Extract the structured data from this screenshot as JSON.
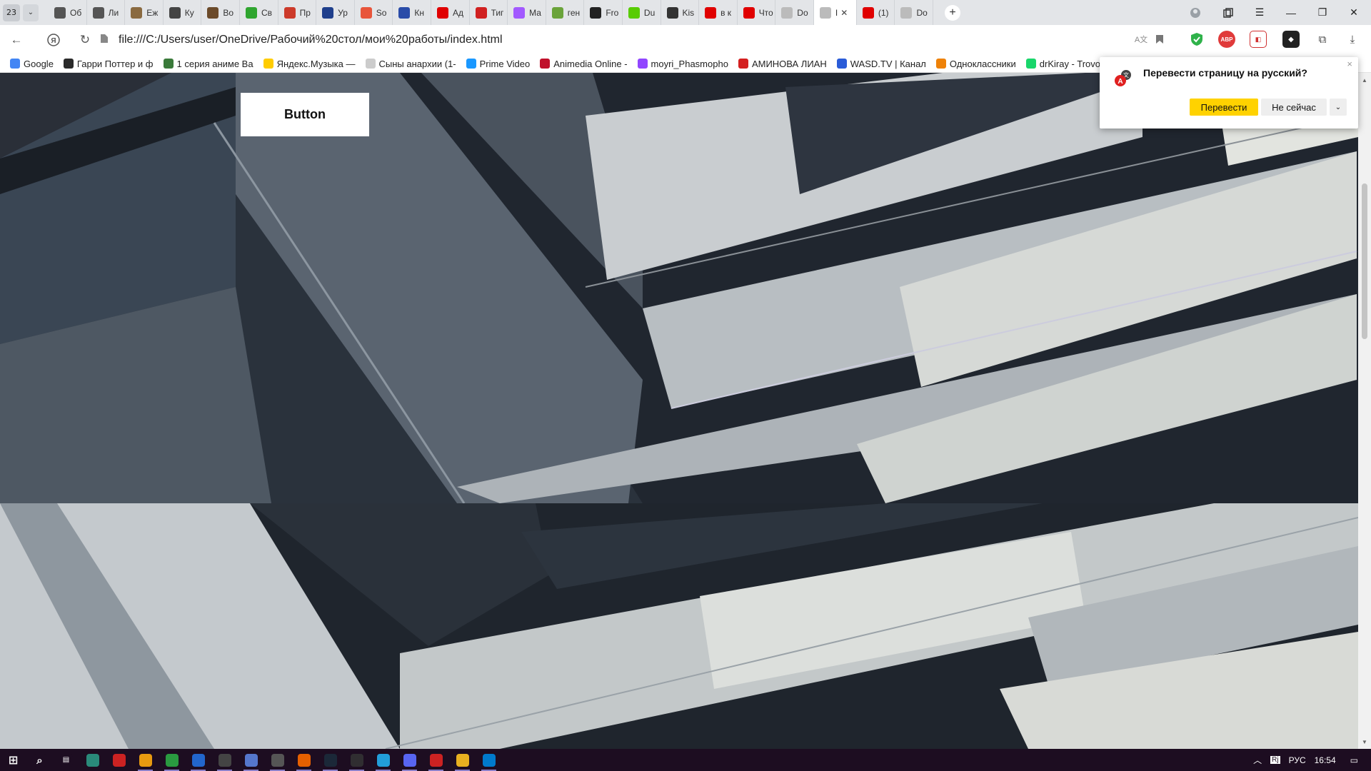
{
  "browser": {
    "tab_count": "23",
    "tabs": [
      {
        "label": "Об",
        "icon": "shield-icon",
        "color": "#555555"
      },
      {
        "label": "Ли",
        "icon": "shield-icon",
        "color": "#555555"
      },
      {
        "label": "Еж",
        "icon": "hedgehog-icon",
        "color": "#8a6a40"
      },
      {
        "label": "Ку",
        "icon": "shield-outline-icon",
        "color": "#444444"
      },
      {
        "label": "Во",
        "icon": "bird-icon",
        "color": "#6b4a2a"
      },
      {
        "label": "Св",
        "icon": "hd-icon",
        "color": "#2fa52f"
      },
      {
        "label": "Пр",
        "icon": "logo-icon",
        "color": "#cc3a2a"
      },
      {
        "label": "Ур",
        "icon": "uk-flag-icon",
        "color": "#1f3f8c"
      },
      {
        "label": "So",
        "icon": "soundcloud-icon",
        "color": "#e8553b"
      },
      {
        "label": "Кн",
        "icon": "flag-icon",
        "color": "#2a4ca8"
      },
      {
        "label": "Ад",
        "icon": "youtube-icon",
        "color": "#e00000"
      },
      {
        "label": "Тиг",
        "icon": "tiger-icon",
        "color": "#d02020"
      },
      {
        "label": "Ма",
        "icon": "figma-icon",
        "color": "#a259ff"
      },
      {
        "label": "ген",
        "icon": "leaf-icon",
        "color": "#6aa33a"
      },
      {
        "label": "Fro",
        "icon": "circle-icon",
        "color": "#222222"
      },
      {
        "label": "Du",
        "icon": "duolingo-icon",
        "color": "#58cc02"
      },
      {
        "label": "Kis",
        "icon": "pause-icon",
        "color": "#333333"
      },
      {
        "label": "в к",
        "icon": "youtube-icon",
        "color": "#e00000"
      },
      {
        "label": "Что",
        "icon": "youtube-icon",
        "color": "#e00000"
      },
      {
        "label": "Do",
        "icon": "document-icon",
        "color": "#bbbbbb"
      },
      {
        "label": "I",
        "icon": "document-icon",
        "color": "#bbbbbb",
        "active": true
      },
      {
        "label": "(1)",
        "icon": "youtube-icon",
        "color": "#e00000"
      },
      {
        "label": "Do",
        "icon": "document-icon",
        "color": "#bbbbbb"
      }
    ],
    "url": "file:///C:/Users/user/OneDrive/Рабочий%20стол/мои%20работы/index.html",
    "bookmarks": [
      {
        "label": "Google",
        "icon": "google-icon",
        "color": "#4285f4"
      },
      {
        "label": "Гарри Поттер и ф",
        "icon": "book-icon",
        "color": "#2a2a2a"
      },
      {
        "label": "1 серия аниме Ва",
        "icon": "eye-icon",
        "color": "#3a7a3a"
      },
      {
        "label": "Яндекс.Музыка —",
        "icon": "music-icon",
        "color": "#ffcc00"
      },
      {
        "label": "Сыны анархии (1-",
        "icon": "document-icon",
        "color": "#cccccc"
      },
      {
        "label": "Prime Video",
        "icon": "play-icon",
        "color": "#1a98ff"
      },
      {
        "label": "Animedia Online -",
        "icon": "animedia-icon",
        "color": "#c0102a"
      },
      {
        "label": "moyri_Phasmopho",
        "icon": "twitch-icon",
        "color": "#9146ff"
      },
      {
        "label": "АМИНОВА ЛИАН",
        "icon": "slash-icon",
        "color": "#d42020"
      },
      {
        "label": "WASD.TV | Канал",
        "icon": "wasd-icon",
        "color": "#2a5cd8"
      },
      {
        "label": "Одноклассники",
        "icon": "ok-icon",
        "color": "#ee8208"
      },
      {
        "label": "drKiray - Trovo",
        "icon": "trovo-icon",
        "color": "#19d66b"
      }
    ]
  },
  "page": {
    "button_label": "Button"
  },
  "translate_popup": {
    "title": "Перевести страницу на русский?",
    "translate_label": "Перевести",
    "not_now_label": "Не сейчас",
    "close_glyph": "×",
    "more_glyph": "⌄"
  },
  "taskbar": {
    "language": "РУС",
    "time": "16:54",
    "apps": [
      {
        "icon": "windows-start-icon",
        "color": "#1d0d21"
      },
      {
        "icon": "search-icon",
        "color": "#1d0d21"
      },
      {
        "icon": "task-view-icon",
        "color": "#1d0d21"
      },
      {
        "icon": "globe-app-icon",
        "color": "#2a8a7a"
      },
      {
        "icon": "yandex-icon",
        "color": "#cc2222"
      },
      {
        "icon": "yandex-music-icon",
        "color": "#e89a10"
      },
      {
        "icon": "chrome-icon",
        "color": "#2a9a40"
      },
      {
        "icon": "monitor-app-icon",
        "color": "#2266cc"
      },
      {
        "icon": "tool-app-icon",
        "color": "#444444"
      },
      {
        "icon": "arrow-app-icon",
        "color": "#5577cc"
      },
      {
        "icon": "calculator-icon",
        "color": "#555555"
      },
      {
        "icon": "firefox-icon",
        "color": "#e66000"
      },
      {
        "icon": "steam-icon",
        "color": "#1b2838"
      },
      {
        "icon": "obs-icon",
        "color": "#302e31"
      },
      {
        "icon": "telegram-icon",
        "color": "#229ed9"
      },
      {
        "icon": "discord-icon",
        "color": "#5865f2"
      },
      {
        "icon": "yandex-browser-icon",
        "color": "#cc2222"
      },
      {
        "icon": "file-explorer-icon",
        "color": "#e8b020"
      },
      {
        "icon": "vscode-icon",
        "color": "#007acc"
      }
    ]
  }
}
